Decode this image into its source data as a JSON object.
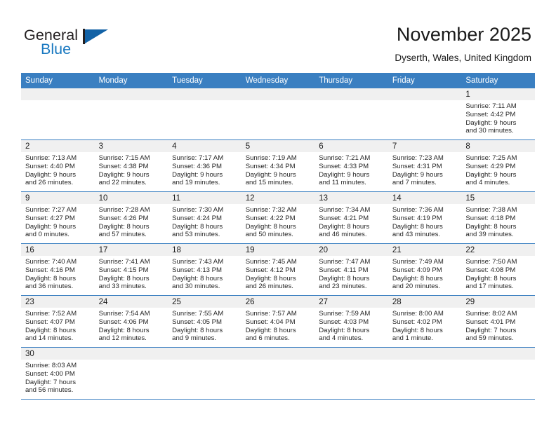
{
  "brand": {
    "name_part1": "General",
    "name_part2": "Blue",
    "flag_icon": "triangle-flag-icon",
    "accent_color": "#1878c0"
  },
  "header": {
    "title": "November 2025",
    "subtitle": "Dyserth, Wales, United Kingdom"
  },
  "theme": {
    "header_blue": "#3a7fc1",
    "band_gray": "#f0f0f0"
  },
  "weekday_headers": [
    "Sunday",
    "Monday",
    "Tuesday",
    "Wednesday",
    "Thursday",
    "Friday",
    "Saturday"
  ],
  "weeks": [
    [
      {
        "day": "",
        "sunrise": "",
        "sunset": "",
        "daylight_line1": "",
        "daylight_line2": ""
      },
      {
        "day": "",
        "sunrise": "",
        "sunset": "",
        "daylight_line1": "",
        "daylight_line2": ""
      },
      {
        "day": "",
        "sunrise": "",
        "sunset": "",
        "daylight_line1": "",
        "daylight_line2": ""
      },
      {
        "day": "",
        "sunrise": "",
        "sunset": "",
        "daylight_line1": "",
        "daylight_line2": ""
      },
      {
        "day": "",
        "sunrise": "",
        "sunset": "",
        "daylight_line1": "",
        "daylight_line2": ""
      },
      {
        "day": "",
        "sunrise": "",
        "sunset": "",
        "daylight_line1": "",
        "daylight_line2": ""
      },
      {
        "day": "1",
        "sunrise": "Sunrise: 7:11 AM",
        "sunset": "Sunset: 4:42 PM",
        "daylight_line1": "Daylight: 9 hours",
        "daylight_line2": "and 30 minutes."
      }
    ],
    [
      {
        "day": "2",
        "sunrise": "Sunrise: 7:13 AM",
        "sunset": "Sunset: 4:40 PM",
        "daylight_line1": "Daylight: 9 hours",
        "daylight_line2": "and 26 minutes."
      },
      {
        "day": "3",
        "sunrise": "Sunrise: 7:15 AM",
        "sunset": "Sunset: 4:38 PM",
        "daylight_line1": "Daylight: 9 hours",
        "daylight_line2": "and 22 minutes."
      },
      {
        "day": "4",
        "sunrise": "Sunrise: 7:17 AM",
        "sunset": "Sunset: 4:36 PM",
        "daylight_line1": "Daylight: 9 hours",
        "daylight_line2": "and 19 minutes."
      },
      {
        "day": "5",
        "sunrise": "Sunrise: 7:19 AM",
        "sunset": "Sunset: 4:34 PM",
        "daylight_line1": "Daylight: 9 hours",
        "daylight_line2": "and 15 minutes."
      },
      {
        "day": "6",
        "sunrise": "Sunrise: 7:21 AM",
        "sunset": "Sunset: 4:33 PM",
        "daylight_line1": "Daylight: 9 hours",
        "daylight_line2": "and 11 minutes."
      },
      {
        "day": "7",
        "sunrise": "Sunrise: 7:23 AM",
        "sunset": "Sunset: 4:31 PM",
        "daylight_line1": "Daylight: 9 hours",
        "daylight_line2": "and 7 minutes."
      },
      {
        "day": "8",
        "sunrise": "Sunrise: 7:25 AM",
        "sunset": "Sunset: 4:29 PM",
        "daylight_line1": "Daylight: 9 hours",
        "daylight_line2": "and 4 minutes."
      }
    ],
    [
      {
        "day": "9",
        "sunrise": "Sunrise: 7:27 AM",
        "sunset": "Sunset: 4:27 PM",
        "daylight_line1": "Daylight: 9 hours",
        "daylight_line2": "and 0 minutes."
      },
      {
        "day": "10",
        "sunrise": "Sunrise: 7:28 AM",
        "sunset": "Sunset: 4:26 PM",
        "daylight_line1": "Daylight: 8 hours",
        "daylight_line2": "and 57 minutes."
      },
      {
        "day": "11",
        "sunrise": "Sunrise: 7:30 AM",
        "sunset": "Sunset: 4:24 PM",
        "daylight_line1": "Daylight: 8 hours",
        "daylight_line2": "and 53 minutes."
      },
      {
        "day": "12",
        "sunrise": "Sunrise: 7:32 AM",
        "sunset": "Sunset: 4:22 PM",
        "daylight_line1": "Daylight: 8 hours",
        "daylight_line2": "and 50 minutes."
      },
      {
        "day": "13",
        "sunrise": "Sunrise: 7:34 AM",
        "sunset": "Sunset: 4:21 PM",
        "daylight_line1": "Daylight: 8 hours",
        "daylight_line2": "and 46 minutes."
      },
      {
        "day": "14",
        "sunrise": "Sunrise: 7:36 AM",
        "sunset": "Sunset: 4:19 PM",
        "daylight_line1": "Daylight: 8 hours",
        "daylight_line2": "and 43 minutes."
      },
      {
        "day": "15",
        "sunrise": "Sunrise: 7:38 AM",
        "sunset": "Sunset: 4:18 PM",
        "daylight_line1": "Daylight: 8 hours",
        "daylight_line2": "and 39 minutes."
      }
    ],
    [
      {
        "day": "16",
        "sunrise": "Sunrise: 7:40 AM",
        "sunset": "Sunset: 4:16 PM",
        "daylight_line1": "Daylight: 8 hours",
        "daylight_line2": "and 36 minutes."
      },
      {
        "day": "17",
        "sunrise": "Sunrise: 7:41 AM",
        "sunset": "Sunset: 4:15 PM",
        "daylight_line1": "Daylight: 8 hours",
        "daylight_line2": "and 33 minutes."
      },
      {
        "day": "18",
        "sunrise": "Sunrise: 7:43 AM",
        "sunset": "Sunset: 4:13 PM",
        "daylight_line1": "Daylight: 8 hours",
        "daylight_line2": "and 30 minutes."
      },
      {
        "day": "19",
        "sunrise": "Sunrise: 7:45 AM",
        "sunset": "Sunset: 4:12 PM",
        "daylight_line1": "Daylight: 8 hours",
        "daylight_line2": "and 26 minutes."
      },
      {
        "day": "20",
        "sunrise": "Sunrise: 7:47 AM",
        "sunset": "Sunset: 4:11 PM",
        "daylight_line1": "Daylight: 8 hours",
        "daylight_line2": "and 23 minutes."
      },
      {
        "day": "21",
        "sunrise": "Sunrise: 7:49 AM",
        "sunset": "Sunset: 4:09 PM",
        "daylight_line1": "Daylight: 8 hours",
        "daylight_line2": "and 20 minutes."
      },
      {
        "day": "22",
        "sunrise": "Sunrise: 7:50 AM",
        "sunset": "Sunset: 4:08 PM",
        "daylight_line1": "Daylight: 8 hours",
        "daylight_line2": "and 17 minutes."
      }
    ],
    [
      {
        "day": "23",
        "sunrise": "Sunrise: 7:52 AM",
        "sunset": "Sunset: 4:07 PM",
        "daylight_line1": "Daylight: 8 hours",
        "daylight_line2": "and 14 minutes."
      },
      {
        "day": "24",
        "sunrise": "Sunrise: 7:54 AM",
        "sunset": "Sunset: 4:06 PM",
        "daylight_line1": "Daylight: 8 hours",
        "daylight_line2": "and 12 minutes."
      },
      {
        "day": "25",
        "sunrise": "Sunrise: 7:55 AM",
        "sunset": "Sunset: 4:05 PM",
        "daylight_line1": "Daylight: 8 hours",
        "daylight_line2": "and 9 minutes."
      },
      {
        "day": "26",
        "sunrise": "Sunrise: 7:57 AM",
        "sunset": "Sunset: 4:04 PM",
        "daylight_line1": "Daylight: 8 hours",
        "daylight_line2": "and 6 minutes."
      },
      {
        "day": "27",
        "sunrise": "Sunrise: 7:59 AM",
        "sunset": "Sunset: 4:03 PM",
        "daylight_line1": "Daylight: 8 hours",
        "daylight_line2": "and 4 minutes."
      },
      {
        "day": "28",
        "sunrise": "Sunrise: 8:00 AM",
        "sunset": "Sunset: 4:02 PM",
        "daylight_line1": "Daylight: 8 hours",
        "daylight_line2": "and 1 minute."
      },
      {
        "day": "29",
        "sunrise": "Sunrise: 8:02 AM",
        "sunset": "Sunset: 4:01 PM",
        "daylight_line1": "Daylight: 7 hours",
        "daylight_line2": "and 59 minutes."
      }
    ],
    [
      {
        "day": "30",
        "sunrise": "Sunrise: 8:03 AM",
        "sunset": "Sunset: 4:00 PM",
        "daylight_line1": "Daylight: 7 hours",
        "daylight_line2": "and 56 minutes."
      },
      {
        "day": "",
        "sunrise": "",
        "sunset": "",
        "daylight_line1": "",
        "daylight_line2": ""
      },
      {
        "day": "",
        "sunrise": "",
        "sunset": "",
        "daylight_line1": "",
        "daylight_line2": ""
      },
      {
        "day": "",
        "sunrise": "",
        "sunset": "",
        "daylight_line1": "",
        "daylight_line2": ""
      },
      {
        "day": "",
        "sunrise": "",
        "sunset": "",
        "daylight_line1": "",
        "daylight_line2": ""
      },
      {
        "day": "",
        "sunrise": "",
        "sunset": "",
        "daylight_line1": "",
        "daylight_line2": ""
      },
      {
        "day": "",
        "sunrise": "",
        "sunset": "",
        "daylight_line1": "",
        "daylight_line2": ""
      }
    ]
  ]
}
